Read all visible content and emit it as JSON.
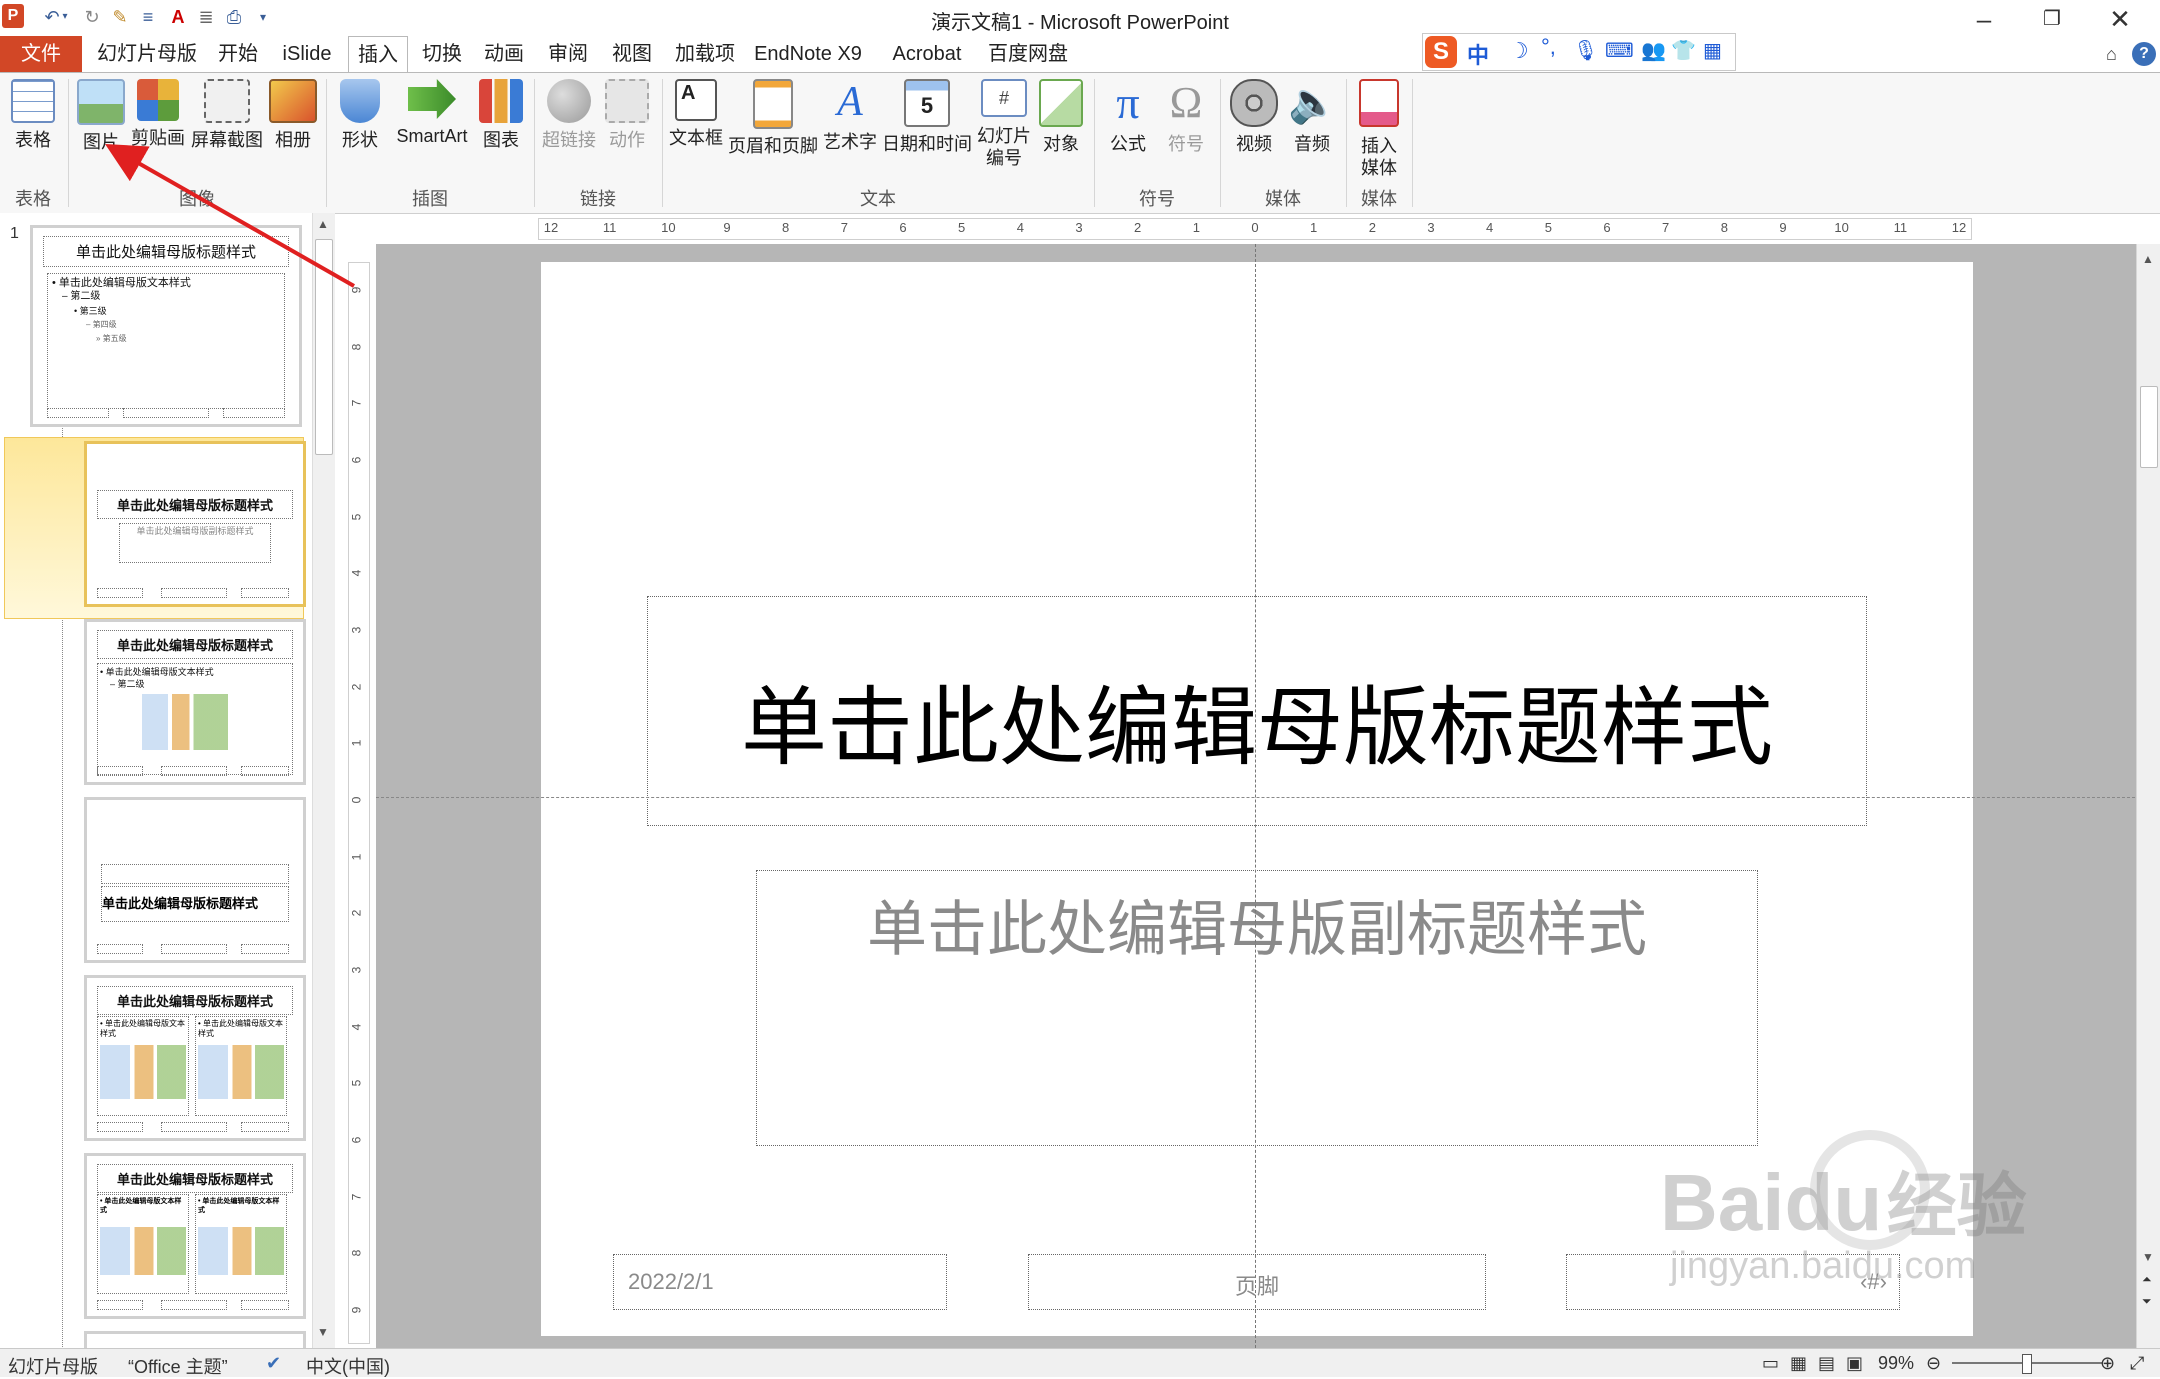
{
  "app": {
    "window_title": "演示文稿1 - Microsoft PowerPoint"
  },
  "tabs": [
    {
      "label": "文件"
    },
    {
      "label": "幻灯片母版"
    },
    {
      "label": "开始"
    },
    {
      "label": "iSlide"
    },
    {
      "label": "插入"
    },
    {
      "label": "切换"
    },
    {
      "label": "动画"
    },
    {
      "label": "审阅"
    },
    {
      "label": "视图"
    },
    {
      "label": "加载项"
    },
    {
      "label": "EndNote X9"
    },
    {
      "label": "Acrobat"
    },
    {
      "label": "百度网盘"
    }
  ],
  "ribbon": {
    "groups": {
      "tables": "表格",
      "images": "图像",
      "illustrations": "插图",
      "links": "链接",
      "text": "文本",
      "symbols": "符号",
      "media": "媒体",
      "media2": "媒体"
    },
    "buttons": {
      "table": "表格",
      "picture": "图片",
      "clipart": "剪贴画",
      "screenshot": "屏幕截图",
      "album": "相册",
      "shapes": "形状",
      "smartart": "SmartArt",
      "chart": "图表",
      "hyperlink": "超链接",
      "action": "动作",
      "textbox": "文本框",
      "header_footer": "页眉和页脚",
      "wordart": "艺术字",
      "datetime": "日期和时间",
      "slide_number_1": "幻灯片",
      "slide_number_2": "编号",
      "object": "对象",
      "equation": "公式",
      "symbol": "符号",
      "video": "视频",
      "audio": "音频",
      "insert_media_1": "插入",
      "insert_media_2": "媒体"
    }
  },
  "thumbnails": {
    "master_number": "1",
    "master_title": "单击此处编辑母版标题样式",
    "master_body_l1": "• 单击此处编辑母版文本样式",
    "master_body_l2": "– 第二级",
    "master_body_l3": "• 第三级",
    "master_body_l4": "– 第四级",
    "master_body_l5": "» 第五级",
    "layout_title": "单击此处编辑母版标题样式",
    "layout_subtitle": "单击此处编辑母版副标题样式",
    "layout_body": "• 单击此处编辑母版文本样式",
    "layout_l2": "– 第二级",
    "layout_col_text": "• 单击此处编辑母版文本样式"
  },
  "slide": {
    "title": "单击此处编辑母版标题样式",
    "subtitle": "单击此处编辑母版副标题样式",
    "date": "2022/2/1",
    "footer": "页脚",
    "page_number": "‹#›"
  },
  "status": {
    "view": "幻灯片母版",
    "theme": "“Office 主题”",
    "language": "中文(中国)",
    "zoom": "99%"
  },
  "ruler": {
    "h_ticks": [
      "12",
      "11",
      "10",
      "9",
      "8",
      "7",
      "6",
      "5",
      "4",
      "3",
      "2",
      "1",
      "0",
      "1",
      "2",
      "3",
      "4",
      "5",
      "6",
      "7",
      "8",
      "9",
      "10",
      "11",
      "12"
    ],
    "v_ticks": [
      "9",
      "8",
      "7",
      "6",
      "5",
      "4",
      "3",
      "2",
      "1",
      "0",
      "1",
      "2",
      "3",
      "4",
      "5",
      "6",
      "7",
      "8",
      "9"
    ]
  },
  "ime": {
    "mode": "中"
  },
  "watermark": {
    "brand": "Baidu",
    "brand_cn": "经验",
    "url": "jingyan.baidu.com"
  },
  "colors": {
    "file_tab": "#d24726",
    "annotation_arrow": "#e02020"
  }
}
